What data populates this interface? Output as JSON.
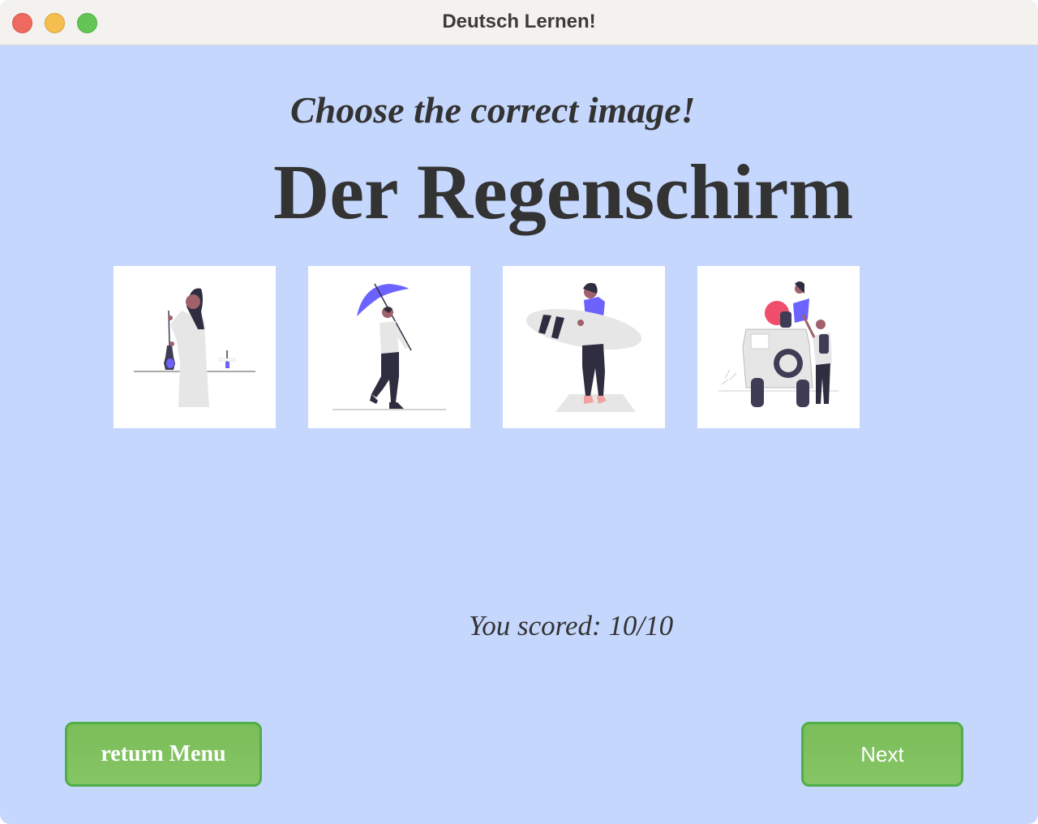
{
  "window": {
    "title": "Deutsch Lernen!"
  },
  "quiz": {
    "prompt": "Choose the correct image!",
    "word": "Der Regenschirm",
    "choices": [
      {
        "icon": "woman-painting-illustration"
      },
      {
        "icon": "man-with-umbrella-illustration"
      },
      {
        "icon": "man-with-surfboard-illustration"
      },
      {
        "icon": "people-with-jeep-illustration"
      }
    ],
    "score_text": "You scored: 10/10"
  },
  "buttons": {
    "menu_label": "return Menu",
    "next_label": "Next"
  },
  "colors": {
    "background": "#c6d7fd",
    "button": "#7bbd59",
    "button_border": "#4fae4a",
    "accent": "#6c63ff"
  }
}
